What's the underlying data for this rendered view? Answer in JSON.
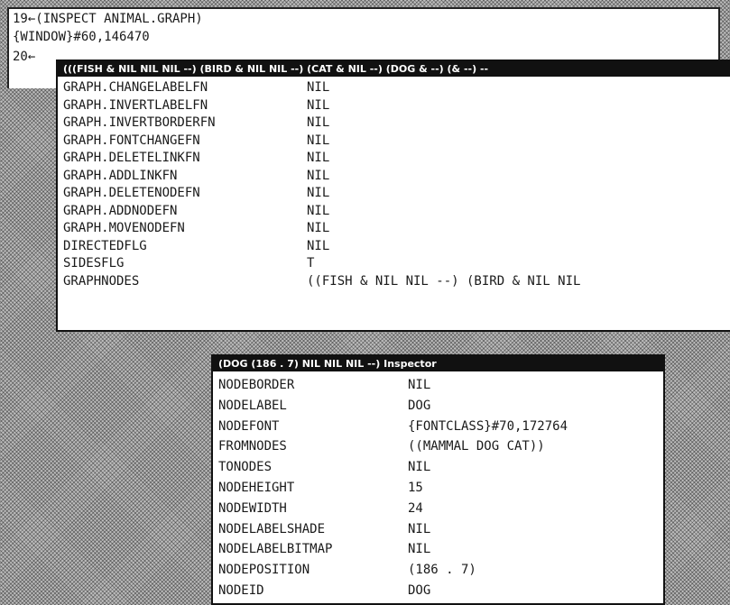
{
  "exec_window": {
    "line1": "19←(INSPECT ANIMAL.GRAPH)",
    "line2": "{WINDOW}#60,146470",
    "line3": "20←"
  },
  "graph_inspector": {
    "title": "(((FISH & NIL NIL NIL --) (BIRD & NIL NIL --) (CAT & NIL --) (DOG & --) (& --) --",
    "rows": [
      {
        "key": "GRAPH.CHANGELABELFN",
        "value": "NIL"
      },
      {
        "key": "GRAPH.INVERTLABELFN",
        "value": "NIL"
      },
      {
        "key": "GRAPH.INVERTBORDERFN",
        "value": "NIL"
      },
      {
        "key": "GRAPH.FONTCHANGEFN",
        "value": "NIL"
      },
      {
        "key": "GRAPH.DELETELINKFN",
        "value": "NIL"
      },
      {
        "key": "GRAPH.ADDLINKFN",
        "value": "NIL"
      },
      {
        "key": "GRAPH.DELETENODEFN",
        "value": "NIL"
      },
      {
        "key": "GRAPH.ADDNODEFN",
        "value": "NIL"
      },
      {
        "key": "GRAPH.MOVENODEFN",
        "value": "NIL"
      },
      {
        "key": "DIRECTEDFLG",
        "value": "NIL"
      },
      {
        "key": "SIDESFLG",
        "value": "T"
      },
      {
        "key": "GRAPHNODES",
        "value": "((FISH & NIL NIL --) (BIRD & NIL NIL"
      }
    ]
  },
  "node_inspector": {
    "title": "(DOG (186 . 7) NIL NIL NIL --)  Inspector",
    "rows": [
      {
        "key": "NODEBORDER",
        "value": "NIL"
      },
      {
        "key": "NODELABEL",
        "value": "DOG"
      },
      {
        "key": "NODEFONT",
        "value": "{FONTCLASS}#70,172764"
      },
      {
        "key": "FROMNODES",
        "value": "((MAMMAL DOG CAT))"
      },
      {
        "key": "TONODES",
        "value": "NIL"
      },
      {
        "key": "NODEHEIGHT",
        "value": "15"
      },
      {
        "key": "NODEWIDTH",
        "value": "24"
      },
      {
        "key": "NODELABELSHADE",
        "value": "NIL"
      },
      {
        "key": "NODELABELBITMAP",
        "value": "NIL"
      },
      {
        "key": "NODEPOSITION",
        "value": "(186 . 7)"
      },
      {
        "key": "NODEID",
        "value": "DOG"
      }
    ]
  }
}
